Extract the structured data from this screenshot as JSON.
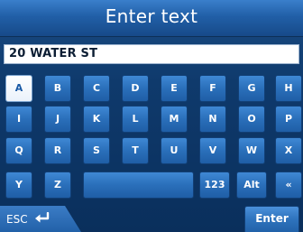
{
  "title": "Enter text",
  "text_field": {
    "value": "20 WATER ST"
  },
  "keys": {
    "row1": [
      "A",
      "B",
      "C",
      "D",
      "E",
      "F",
      "G",
      "H"
    ],
    "row2": [
      "I",
      "J",
      "K",
      "L",
      "M",
      "N",
      "O",
      "P"
    ],
    "row3": [
      "Q",
      "R",
      "S",
      "T",
      "U",
      "V",
      "W",
      "X"
    ],
    "row4": {
      "y": "Y",
      "z": "Z",
      "space": "",
      "num": "123",
      "alt": "Alt",
      "backspace": "«"
    }
  },
  "selected_key": "A",
  "bottom": {
    "esc_label": "ESC",
    "esc_icon": "return-arrow-icon",
    "enter_label": "Enter"
  },
  "colors": {
    "key_blue": "#2a6fba",
    "key_selected": "#ffffff",
    "title_bar": "#215fa7"
  }
}
